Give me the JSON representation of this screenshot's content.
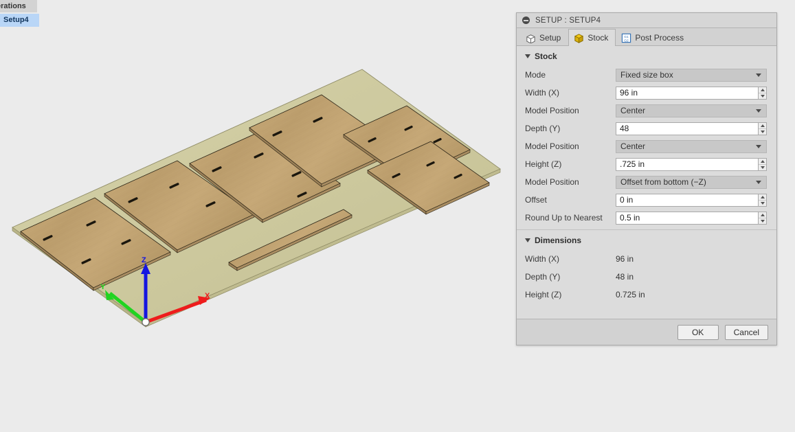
{
  "browser_tree": {
    "truncated_group_label": "erations",
    "selected_item_label": "Setup4",
    "selection_color": "#b9d6f7"
  },
  "dialog": {
    "title": "SETUP : SETUP4",
    "collapse_icon": "minus-circle-icon",
    "tabs": [
      {
        "label": "Setup",
        "icon": "setup-box-icon",
        "active": false
      },
      {
        "label": "Stock",
        "icon": "stock-box-icon",
        "active": true
      },
      {
        "label": "Post Process",
        "icon": "gcode-g1g2-icon",
        "active": false
      }
    ],
    "stock_section": {
      "header": "Stock",
      "rows": [
        {
          "label": "Mode",
          "type": "combo",
          "value": "Fixed size box"
        },
        {
          "label": "Width (X)",
          "type": "number",
          "value": "96 in"
        },
        {
          "label": "Model Position",
          "type": "combo",
          "value": "Center"
        },
        {
          "label": "Depth (Y)",
          "type": "number",
          "value": "48"
        },
        {
          "label": "Model Position",
          "type": "combo",
          "value": "Center"
        },
        {
          "label": "Height (Z)",
          "type": "number",
          "value": ".725 in"
        },
        {
          "label": "Model Position",
          "type": "combo",
          "value": "Offset from bottom (−Z)"
        },
        {
          "label": "Offset",
          "type": "number",
          "value": "0 in"
        },
        {
          "label": "Round Up to Nearest",
          "type": "number",
          "value": "0.5 in"
        }
      ]
    },
    "dimensions_section": {
      "header": "Dimensions",
      "rows": [
        {
          "label": "Width (X)",
          "value": "96 in"
        },
        {
          "label": "Depth (Y)",
          "value": "48 in"
        },
        {
          "label": "Height (Z)",
          "value": "0.725 in"
        }
      ]
    },
    "footer": {
      "ok_label": "OK",
      "cancel_label": "Cancel"
    }
  },
  "viewport": {
    "background_color": "#ebebeb",
    "stock_color": "#cfcba3",
    "wood_color": "#c1a473",
    "origin_triad": {
      "x_label": "X",
      "x_color": "#ee1c1c",
      "y_label": "Y",
      "y_color": "#21d421",
      "z_label": "Z",
      "z_color": "#1515e0"
    }
  }
}
